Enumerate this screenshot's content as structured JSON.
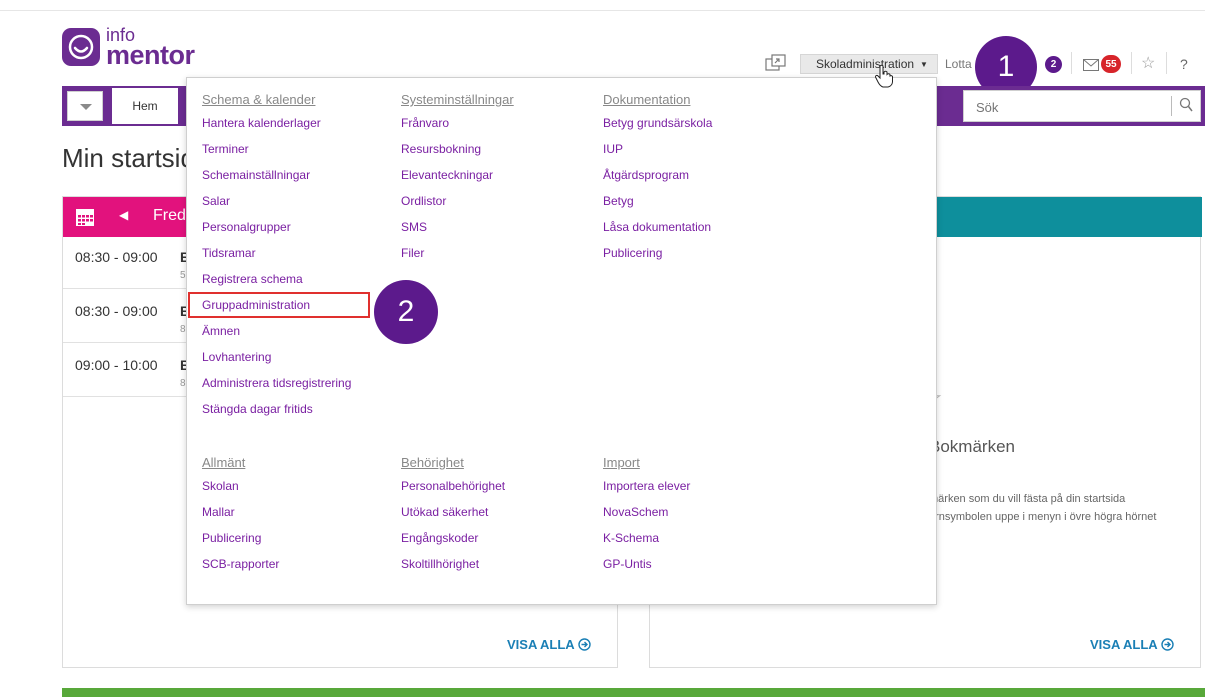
{
  "logo": {
    "line1": "info",
    "line2": "mentor"
  },
  "header": {
    "school_admin_label": "Skoladministration",
    "user_name": "Lotta",
    "notification_count": "2",
    "mail_count": "55",
    "help_label": "?"
  },
  "callouts": {
    "first": "1",
    "second": "2"
  },
  "nav": {
    "home_label": "Hem"
  },
  "search": {
    "placeholder": "Sök"
  },
  "page_title": "Min startsida",
  "calendar": {
    "date_label": "Fredag",
    "rows": [
      {
        "time": "08:30 - 09:00",
        "title": "B",
        "sub": "5"
      },
      {
        "time": "08:30 - 09:00",
        "title": "B",
        "sub": "8"
      },
      {
        "time": "09:00 - 10:00",
        "title": "B",
        "sub": "8"
      }
    ],
    "show_all": "VISA ALLA"
  },
  "bookmarks": {
    "title": "Bokmärken",
    "text_line1": "märken som du vill fästa på din startsida",
    "text_line2": "ärnsymbolen uppe i menyn i övre högra hörnet",
    "show_all": "VISA ALLA"
  },
  "dropdown": {
    "schema": {
      "heading": "Schema & kalender",
      "items": [
        "Hantera kalenderlager",
        "Terminer",
        "Schemainställningar",
        "Salar",
        "Personalgrupper",
        "Tidsramar",
        "Registrera schema",
        "Gruppadministration",
        "Ämnen",
        "Lovhantering",
        "Administrera tidsregistrering",
        "Stängda dagar fritids"
      ]
    },
    "system": {
      "heading": "Systeminställningar",
      "items": [
        "Frånvaro",
        "Resursbokning",
        "Elevanteckningar",
        "Ordlistor",
        "SMS",
        "Filer"
      ]
    },
    "dokumentation": {
      "heading": "Dokumentation",
      "items": [
        "Betyg grundsärskola",
        "IUP",
        "Åtgärdsprogram",
        "Betyg",
        "Låsa dokumentation",
        "Publicering"
      ]
    },
    "allmant": {
      "heading": "Allmänt",
      "items": [
        "Skolan",
        "Mallar",
        "Publicering",
        "SCB-rapporter"
      ]
    },
    "behorighet": {
      "heading": "Behörighet",
      "items": [
        "Personalbehörighet",
        "Utökad säkerhet",
        "Engångskoder",
        "Skoltillhörighet"
      ]
    },
    "import": {
      "heading": "Import",
      "items": [
        "Importera elever",
        "NovaSchem",
        "K-Schema",
        "GP-Untis"
      ]
    }
  },
  "colors": {
    "brand_purple": "#6b2c91",
    "calendar_pink": "#e2127d",
    "bookmark_teal": "#0e8f9c",
    "link_blue": "#1a7fb5",
    "footer_green": "#58a83a",
    "highlight_red": "#e0302e"
  }
}
